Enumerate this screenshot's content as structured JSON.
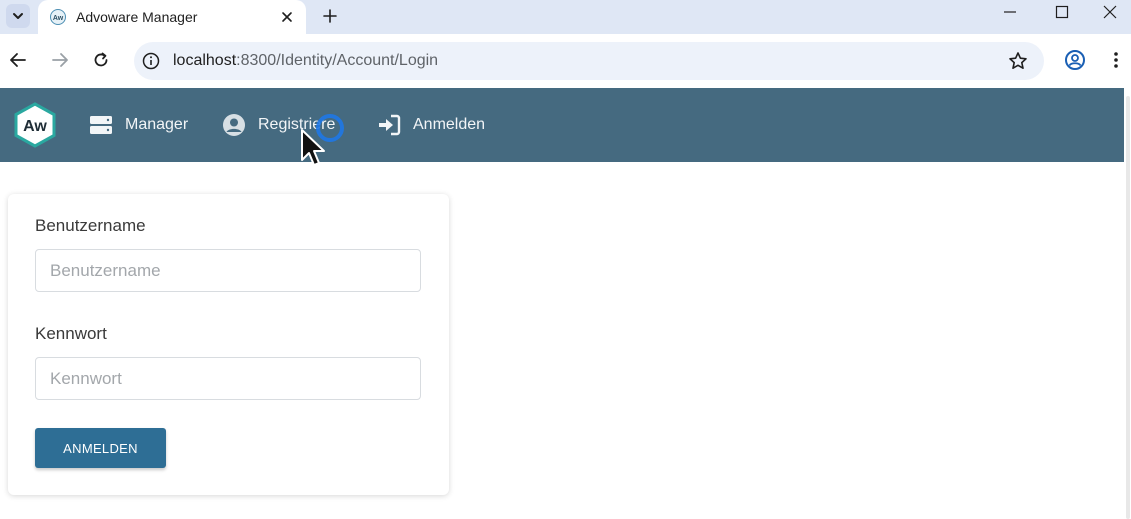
{
  "browser": {
    "tab_title": "Advoware Manager",
    "favicon_text": "Aw",
    "url_host": "localhost",
    "url_path": ":8300/Identity/Account/Login"
  },
  "navbar": {
    "logo_text": "Aw",
    "items": [
      {
        "label": "Manager",
        "icon": "server-icon"
      },
      {
        "label": "Registriere",
        "icon": "user-circle-icon"
      },
      {
        "label": "Anmelden",
        "icon": "sign-in-icon"
      }
    ]
  },
  "login": {
    "username_label": "Benutzername",
    "username_placeholder": "Benutzername",
    "username_value": "",
    "password_label": "Kennwort",
    "password_placeholder": "Kennwort",
    "password_value": "",
    "submit_label": "ANMELDEN"
  },
  "colors": {
    "navbar_bg": "#456a80",
    "button_bg": "#2e6e95",
    "logo_border": "#2aa8a0"
  }
}
